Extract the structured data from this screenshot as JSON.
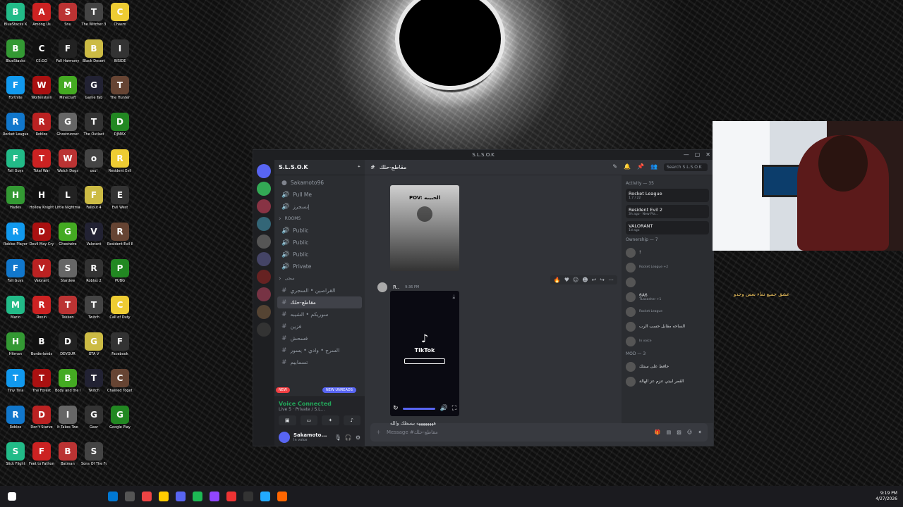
{
  "window": {
    "title": "S.L.S.O.K",
    "controls": [
      "—",
      "▢",
      "✕"
    ]
  },
  "server": {
    "name": "S.L.S.O.K"
  },
  "channels": [
    {
      "type": "member",
      "label": "Sakamoto96"
    },
    {
      "type": "voice",
      "label": "Pull Me"
    },
    {
      "type": "voice",
      "label": "إنسجرز"
    },
    {
      "type": "cat",
      "label": "ROOMS"
    },
    {
      "type": "voice",
      "label": "Public"
    },
    {
      "type": "voice",
      "label": "Public"
    },
    {
      "type": "voice",
      "label": "Public"
    },
    {
      "type": "voice",
      "label": "Private"
    },
    {
      "type": "cat",
      "label": "سجى"
    },
    {
      "type": "text",
      "label": "القراصين • السجري"
    },
    {
      "type": "text",
      "label": "مقاطع-حلك",
      "active": true
    },
    {
      "type": "text",
      "label": "سوريكم • الشيبه"
    },
    {
      "type": "text",
      "label": "فزين"
    },
    {
      "type": "text",
      "label": "فسحش"
    },
    {
      "type": "text",
      "label": "السرج • وادي • يسور"
    },
    {
      "type": "text",
      "label": "تسمابيم"
    }
  ],
  "pills": {
    "new": "NEW",
    "unreads": "NEW UNREADS"
  },
  "voice": {
    "title": "Voice Connected",
    "sub": "Live 5 · Private / S.L..."
  },
  "user": {
    "name": "Sakamoto...",
    "status": "In voice"
  },
  "channel_header": {
    "name": "مقاطع-حلك",
    "search_placeholder": "Search S.L.S.O.K"
  },
  "messages": {
    "image_caption": "POV: الحبيبه",
    "author": "R..",
    "time": "9:36 PM",
    "video_brand": "TikTok",
    "text": "ههههههههه بيسطك والله"
  },
  "composer": {
    "placeholder": "Message #مقاطع-حلك"
  },
  "members": {
    "activity_header": "Activity — 35",
    "activities": [
      {
        "game": "Rocket League",
        "sub": "1.7 / 22"
      },
      {
        "game": "Resident Evil 2",
        "sub": "3h ago · New Pla..."
      },
      {
        "game": "VALORANT",
        "sub": "1d ago"
      }
    ],
    "sections": [
      {
        "title": "Ownership — 7",
        "members": [
          {
            "name": "!",
            "status": ""
          },
          {
            "name": "",
            "status": "Rocket League +2"
          },
          {
            "name": "",
            "status": ""
          },
          {
            "name": "6A6",
            "status": "TLaxasher +1"
          },
          {
            "name": "",
            "status": "Rocket League"
          },
          {
            "name": "الساحه مقابل حسب الرب",
            "status": ""
          },
          {
            "name": "",
            "status": "In voice"
          }
        ]
      },
      {
        "title": "MOD — 3",
        "members": [
          {
            "name": "حافظ على سنتك",
            "status": ""
          },
          {
            "name": "القمر ابيتي عزم عز الهالة",
            "status": ""
          }
        ]
      }
    ]
  },
  "overlay_text": "عشق جميع نماء بعض وجدو",
  "tray": {
    "time": "9:19 PM",
    "date": "4/27/2026"
  },
  "desktop_icons": [
    "BlueStacks X",
    "Among Us",
    "Snu",
    "The Witcher 3",
    "Chasm",
    "BlueStacks",
    "CS:GO",
    "Fall Harmony",
    "Black Desert",
    "INSIDE",
    "Fortnite",
    "Wolfenstein",
    "Minecraft",
    "Game Tab",
    "The Hunter",
    "Rocket League",
    "Roblox",
    "Ghostrunner",
    "The Outlast",
    "DJMAX",
    "Fall Guys",
    "Total War",
    "Watch Dogs",
    "osu!",
    "Resident Evil",
    "Hades",
    "Hollow Knight",
    "Little Nightmares",
    "Fallout 4",
    "Evil West",
    "Roblox Player",
    "Devil May Cry",
    "Ghostwire",
    "Valorant",
    "Resident Evil 8",
    "Fall Guys",
    "Valorant",
    "Stardew",
    "Roblox 2",
    "PUBG",
    "Mario",
    "Ronin",
    "Tekken",
    "Twitch",
    "Call of Duty",
    "Hitman",
    "Borderlands",
    "DEVOUR",
    "GTA V",
    "Facebook",
    "Tiny Tina",
    "The Forest",
    "Body and the Dark",
    "Twitch",
    "Chained Together",
    "Roblox",
    "Don't Starve",
    "It Takes Two",
    "Gear",
    "Google Play",
    "Slick Flight",
    "Feet to Fathom",
    "Batman",
    "Sons Of The Forest"
  ]
}
